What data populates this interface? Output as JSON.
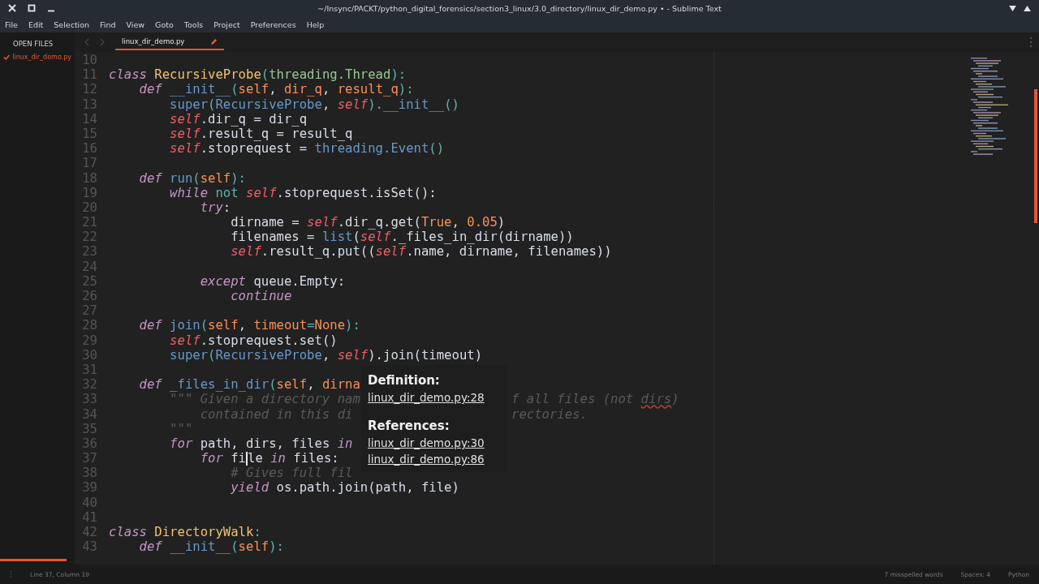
{
  "window": {
    "title": "~/Insync/PACKT/python_digital_forensics/section3_linux/3.0_directory/linux_dir_demo.py • - Sublime Text"
  },
  "menu": [
    "File",
    "Edit",
    "Selection",
    "Find",
    "View",
    "Goto",
    "Tools",
    "Project",
    "Preferences",
    "Help"
  ],
  "sidebar": {
    "header": "OPEN FILES",
    "items": [
      {
        "label": "linux_dir_demo.py",
        "selected": true
      }
    ]
  },
  "tabs": [
    {
      "label": "linux_dir_demo.py",
      "selected": true,
      "dirty": true
    }
  ],
  "lines": [
    {
      "number": "10"
    },
    {
      "number": "11",
      "tokens": [
        {
          "text": "class ",
          "kind": "kw"
        },
        {
          "text": "RecursiveProbe",
          "kind": "name"
        },
        {
          "text": "(",
          "kind": "punct"
        },
        {
          "text": "threading.Thread",
          "kind": "base"
        },
        {
          "text": "):",
          "kind": "punct"
        }
      ]
    },
    {
      "number": "12",
      "tokens": [
        {
          "text": "    def ",
          "kind": "kw"
        },
        {
          "text": "__init__",
          "kind": "fn"
        },
        {
          "text": "(",
          "kind": "punct"
        },
        {
          "text": "self",
          "kind": "param"
        },
        {
          "text": ", ",
          "kind": "plain"
        },
        {
          "text": "dir_q",
          "kind": "param"
        },
        {
          "text": ", ",
          "kind": "plain"
        },
        {
          "text": "result_q",
          "kind": "param"
        },
        {
          "text": "):",
          "kind": "punct"
        }
      ]
    },
    {
      "number": "13",
      "tokens": [
        {
          "text": "        super",
          "kind": "fn"
        },
        {
          "text": "(",
          "kind": "punct"
        },
        {
          "text": "RecursiveProbe",
          "kind": "fn"
        },
        {
          "text": ", ",
          "kind": "plain"
        },
        {
          "text": "self",
          "kind": "self"
        },
        {
          "text": ").",
          "kind": "punct"
        },
        {
          "text": "__init__",
          "kind": "fn"
        },
        {
          "text": "()",
          "kind": "punct"
        }
      ]
    },
    {
      "number": "14",
      "tokens": [
        {
          "text": "        self",
          "kind": "self"
        },
        {
          "text": ".dir_q = dir_q",
          "kind": "plain"
        }
      ]
    },
    {
      "number": "15",
      "tokens": [
        {
          "text": "        self",
          "kind": "self"
        },
        {
          "text": ".result_q = result_q",
          "kind": "plain"
        }
      ]
    },
    {
      "number": "16",
      "tokens": [
        {
          "text": "        self",
          "kind": "self"
        },
        {
          "text": ".stoprequest = ",
          "kind": "plain"
        },
        {
          "text": "threading.Event",
          "kind": "fn"
        },
        {
          "text": "()",
          "kind": "punct"
        }
      ]
    },
    {
      "number": "17"
    },
    {
      "number": "18",
      "tokens": [
        {
          "text": "    def ",
          "kind": "kw"
        },
        {
          "text": "run",
          "kind": "fn"
        },
        {
          "text": "(",
          "kind": "punct"
        },
        {
          "text": "self",
          "kind": "param"
        },
        {
          "text": "):",
          "kind": "punct"
        }
      ]
    },
    {
      "number": "19",
      "tokens": [
        {
          "text": "        while",
          "kind": "kw"
        },
        {
          "text": " not ",
          "kind": "punct"
        },
        {
          "text": "self",
          "kind": "self"
        },
        {
          "text": ".stoprequest.isSet():",
          "kind": "plain"
        }
      ]
    },
    {
      "number": "20",
      "tokens": [
        {
          "text": "            try",
          "kind": "kw"
        },
        {
          "text": ":",
          "kind": "plain"
        }
      ]
    },
    {
      "number": "21",
      "tokens": [
        {
          "text": "                dirname = ",
          "kind": "plain"
        },
        {
          "text": "self",
          "kind": "self"
        },
        {
          "text": ".dir_q.get(",
          "kind": "plain"
        },
        {
          "text": "True",
          "kind": "num"
        },
        {
          "text": ", ",
          "kind": "plain"
        },
        {
          "text": "0.05",
          "kind": "num"
        },
        {
          "text": ")",
          "kind": "plain"
        }
      ]
    },
    {
      "number": "22",
      "tokens": [
        {
          "text": "                filenames = ",
          "kind": "plain"
        },
        {
          "text": "list",
          "kind": "fn"
        },
        {
          "text": "(",
          "kind": "plain"
        },
        {
          "text": "self",
          "kind": "self"
        },
        {
          "text": "._files_in_dir(dirname))",
          "kind": "plain"
        }
      ]
    },
    {
      "number": "23",
      "tokens": [
        {
          "text": "                self",
          "kind": "self"
        },
        {
          "text": ".result_q.put((",
          "kind": "plain"
        },
        {
          "text": "self",
          "kind": "self"
        },
        {
          "text": ".name, dirname, filenames))",
          "kind": "plain"
        }
      ]
    },
    {
      "number": "24"
    },
    {
      "number": "25",
      "tokens": [
        {
          "text": "            except",
          "kind": "kw"
        },
        {
          "text": " queue.Empty:",
          "kind": "plain"
        }
      ]
    },
    {
      "number": "26",
      "tokens": [
        {
          "text": "                continue",
          "kind": "kw"
        }
      ]
    },
    {
      "number": "27"
    },
    {
      "number": "28",
      "tokens": [
        {
          "text": "    def ",
          "kind": "kw"
        },
        {
          "text": "join",
          "kind": "fn"
        },
        {
          "text": "(",
          "kind": "punct"
        },
        {
          "text": "self",
          "kind": "param"
        },
        {
          "text": ", ",
          "kind": "plain"
        },
        {
          "text": "timeout",
          "kind": "param"
        },
        {
          "text": "=",
          "kind": "punct"
        },
        {
          "text": "None",
          "kind": "num"
        },
        {
          "text": "):",
          "kind": "punct"
        }
      ]
    },
    {
      "number": "29",
      "tokens": [
        {
          "text": "        self",
          "kind": "self"
        },
        {
          "text": ".stoprequest.set()",
          "kind": "plain"
        }
      ]
    },
    {
      "number": "30",
      "tokens": [
        {
          "text": "        super",
          "kind": "fn"
        },
        {
          "text": "(",
          "kind": "punct"
        },
        {
          "text": "RecursiveProbe",
          "kind": "fn"
        },
        {
          "text": ", ",
          "kind": "plain"
        },
        {
          "text": "self",
          "kind": "self"
        },
        {
          "text": ").join(timeout)",
          "kind": "plain"
        }
      ]
    },
    {
      "number": "31"
    },
    {
      "number": "32",
      "tokens": [
        {
          "text": "    def ",
          "kind": "kw"
        },
        {
          "text": "_files_in_dir",
          "kind": "fn"
        },
        {
          "text": "(",
          "kind": "punct"
        },
        {
          "text": "self",
          "kind": "param"
        },
        {
          "text": ", ",
          "kind": "plain"
        },
        {
          "text": "dirna",
          "kind": "param"
        }
      ]
    },
    {
      "number": "33",
      "tokens": [
        {
          "text": "        \"\"\" Given a directory nam",
          "kind": "comment"
        }
      ],
      "tail": [
        {
          "text": "f all files (not ",
          "kind": "comment"
        },
        {
          "text": "dirs",
          "kind": "misspelled"
        },
        {
          "text": ")",
          "kind": "comment"
        }
      ]
    },
    {
      "number": "34",
      "tokens": [
        {
          "text": "            contained in this di",
          "kind": "comment"
        }
      ],
      "tail": [
        {
          "text": "rectories.",
          "kind": "comment"
        }
      ]
    },
    {
      "number": "35",
      "tokens": [
        {
          "text": "        \"\"\"",
          "kind": "comment"
        }
      ]
    },
    {
      "number": "36",
      "tokens": [
        {
          "text": "        for",
          "kind": "kw"
        },
        {
          "text": " path, dirs, files ",
          "kind": "plain"
        },
        {
          "text": "in",
          "kind": "kw"
        }
      ]
    },
    {
      "number": "37",
      "tokens": [
        {
          "text": "            for",
          "kind": "kw"
        },
        {
          "text": " fi",
          "kind": "plain",
          "cursor": true
        },
        {
          "text": "le ",
          "kind": "plain"
        },
        {
          "text": "in",
          "kind": "kw"
        },
        {
          "text": " files:",
          "kind": "plain"
        }
      ]
    },
    {
      "number": "38",
      "tokens": [
        {
          "text": "                # Gives full fil",
          "kind": "comment"
        }
      ]
    },
    {
      "number": "39",
      "tokens": [
        {
          "text": "                yield",
          "kind": "kw"
        },
        {
          "text": " os.path.join(path, file)",
          "kind": "plain"
        }
      ]
    },
    {
      "number": "40"
    },
    {
      "number": "41"
    },
    {
      "number": "42",
      "tokens": [
        {
          "text": "class ",
          "kind": "kw"
        },
        {
          "text": "DirectoryWalk",
          "kind": "name"
        },
        {
          "text": ":",
          "kind": "punct"
        }
      ]
    },
    {
      "number": "43",
      "tokens": [
        {
          "text": "    def ",
          "kind": "kw"
        },
        {
          "text": "__init__",
          "kind": "fn"
        },
        {
          "text": "(",
          "kind": "punct"
        },
        {
          "text": "self",
          "kind": "param"
        },
        {
          "text": "):",
          "kind": "punct"
        }
      ]
    }
  ],
  "popup": {
    "sections": [
      {
        "heading": "Definition:",
        "links": [
          "linux_dir_demo.py:28"
        ]
      },
      {
        "heading": "References:",
        "links": [
          "linux_dir_demo.py:30",
          "linux_dir_demo.py:86"
        ]
      }
    ]
  },
  "status_bar": {
    "position": "Line 37, Column 19",
    "spelling": "7 misspelled words",
    "indentation": "Spaces: 4",
    "syntax": "Python"
  }
}
